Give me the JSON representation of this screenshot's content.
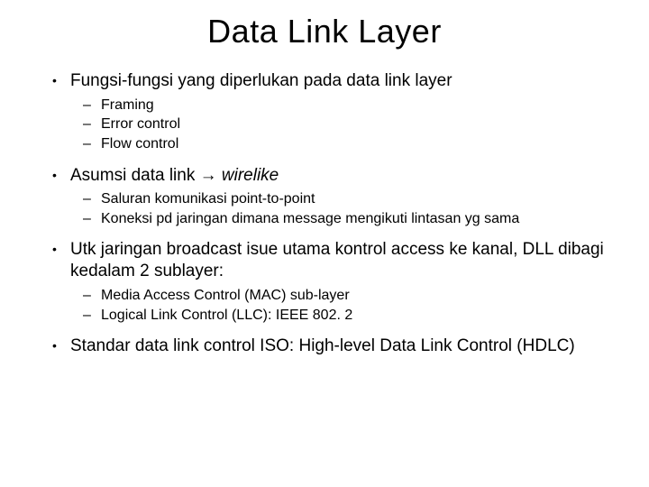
{
  "title": "Data Link Layer",
  "bullets": [
    {
      "text": "Fungsi-fungsi yang diperlukan pada data link layer",
      "subs": [
        "Framing",
        "Error control",
        "Flow control"
      ]
    },
    {
      "prefix": "Asumsi data link ",
      "arrow": "→",
      "italicSuffix": " wirelike",
      "subs": [
        "Saluran komunikasi point-to-point",
        "Koneksi pd jaringan dimana message mengikuti lintasan yg sama"
      ]
    },
    {
      "text": "Utk jaringan broadcast isue utama kontrol access ke kanal, DLL dibagi kedalam 2 sublayer:",
      "subs": [
        "Media Access Control (MAC) sub-layer",
        "Logical Link Control (LLC): IEEE 802. 2"
      ]
    },
    {
      "text": "Standar data link control ISO: High-level Data Link Control (HDLC)",
      "subs": []
    }
  ]
}
